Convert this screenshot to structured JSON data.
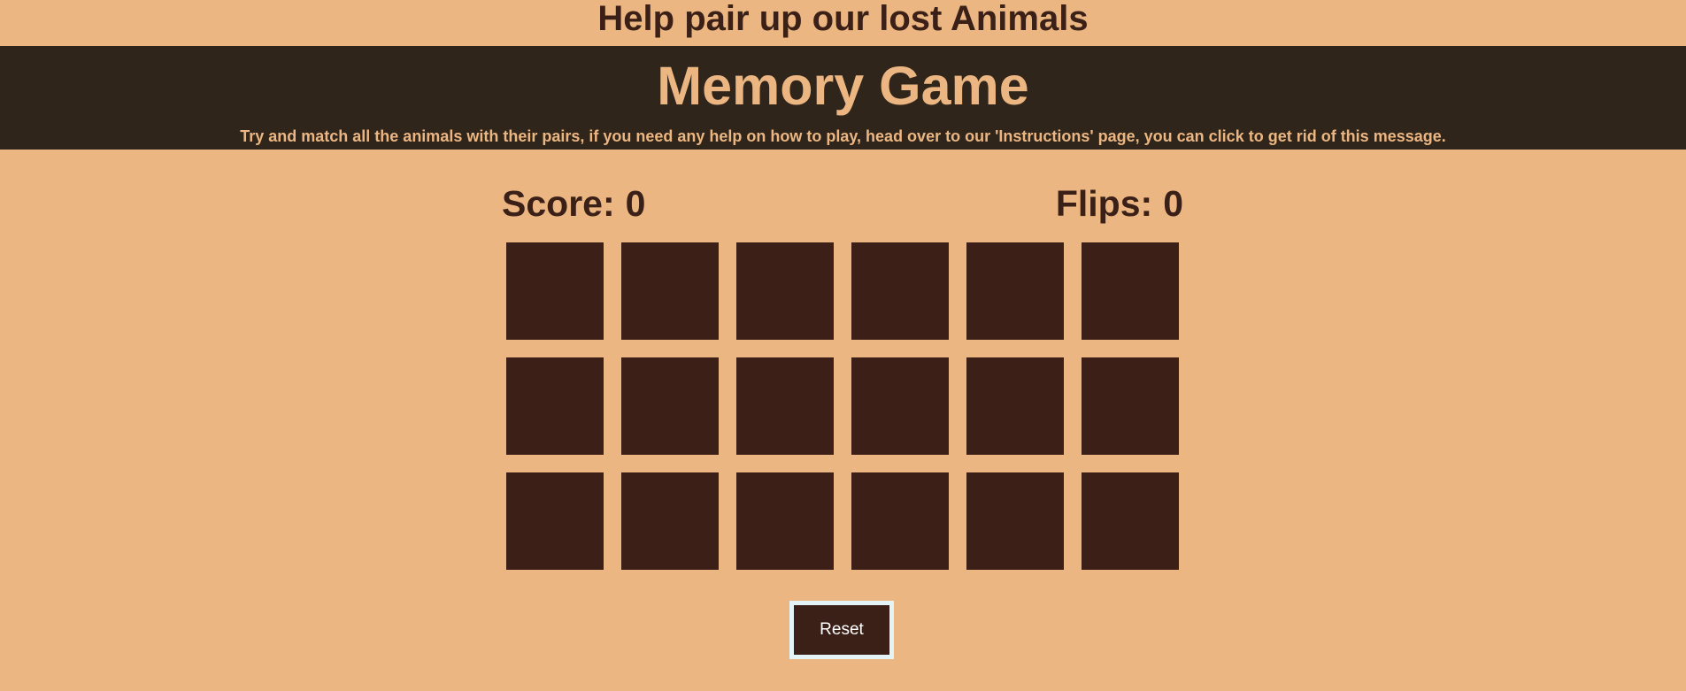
{
  "page": {
    "top_title": "Help pair up our lost Animals"
  },
  "banner": {
    "heading": "Memory Game",
    "message": "Try and match all the animals with their pairs, if you need any help on how to play, head over to our 'Instructions' page, you can click to get rid of this message."
  },
  "stats": {
    "score_label": "Score:",
    "score_value": "0",
    "flips_label": "Flips:",
    "flips_value": "0"
  },
  "board": {
    "rows": 3,
    "columns": 6,
    "cards_face_down": 18
  },
  "controls": {
    "reset_label": "Reset"
  },
  "colors": {
    "background": "#ebb682",
    "banner_background": "#30251b",
    "banner_text": "#ebb682",
    "dark_text": "#3b2018",
    "card_back": "#3c2018",
    "reset_border": "#e4f3f6"
  }
}
